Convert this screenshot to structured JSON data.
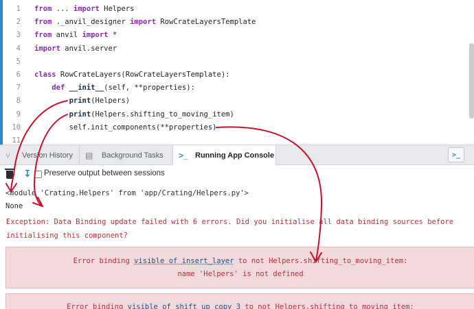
{
  "editor": {
    "lines": [
      {
        "n": "1",
        "parts": [
          [
            "kw",
            "from"
          ],
          [
            "t",
            " ... "
          ],
          [
            "kw",
            "import"
          ],
          [
            "t",
            " Helpers"
          ]
        ]
      },
      {
        "n": "2",
        "parts": [
          [
            "kw",
            "from"
          ],
          [
            "t",
            " ._anvil_designer "
          ],
          [
            "kw",
            "import"
          ],
          [
            "t",
            " RowCrateLayersTemplate"
          ]
        ]
      },
      {
        "n": "3",
        "parts": [
          [
            "kw",
            "from"
          ],
          [
            "t",
            " anvil "
          ],
          [
            "kw",
            "import"
          ],
          [
            "t",
            " *"
          ]
        ]
      },
      {
        "n": "4",
        "parts": [
          [
            "kw",
            "import"
          ],
          [
            "t",
            " anvil.server"
          ]
        ]
      },
      {
        "n": "5",
        "parts": []
      },
      {
        "n": "6",
        "parts": [
          [
            "kw",
            "class"
          ],
          [
            "t",
            " RowCrateLayers(RowCrateLayersTemplate):"
          ]
        ]
      },
      {
        "n": "7",
        "parts": [
          [
            "t",
            "    "
          ],
          [
            "kw",
            "def"
          ],
          [
            "t",
            " "
          ],
          [
            "fn",
            "__init__"
          ],
          [
            "t",
            "(self, **properties):"
          ]
        ]
      },
      {
        "n": "8",
        "parts": [
          [
            "t",
            "        "
          ],
          [
            "fn",
            "print"
          ],
          [
            "t",
            "(Helpers)"
          ]
        ]
      },
      {
        "n": "9",
        "parts": [
          [
            "t",
            "        "
          ],
          [
            "fn",
            "print"
          ],
          [
            "t",
            "(Helpers.shifting_to_moving_item)"
          ]
        ]
      },
      {
        "n": "10",
        "parts": [
          [
            "t",
            "        self.init_components(**properties)"
          ]
        ]
      },
      {
        "n": "11",
        "parts": []
      }
    ]
  },
  "tabs": [
    {
      "label": "Version History",
      "icon": "branch-icon"
    },
    {
      "label": "Background Tasks",
      "icon": "tasks-icon"
    },
    {
      "label": "Running App Console",
      "icon": "console-icon"
    }
  ],
  "toolbar": {
    "preserve_label": "Preserve output between sessions"
  },
  "console": {
    "line1": "<module 'Crating.Helpers' from 'app/Crating/Helpers.py'>",
    "line2": "None",
    "exception_1": "Exception: Data Binding update failed with 6 errors. Did you initialise all data binding sources before",
    "exception_2": "initialising this component?",
    "errors": [
      {
        "prefix": "Error binding ",
        "prop": "visible",
        "of": " of ",
        "component": "insert_layer",
        "to_text": " to not Helpers.shifting_to_moving_item:",
        "message": "name 'Helpers' is not defined"
      },
      {
        "prefix": "Error binding ",
        "prop": "visible",
        "of": " of ",
        "component": "shift_up_copy_3",
        "to_text": " to not Helpers.shifting_to_moving_item:",
        "message": ""
      }
    ]
  },
  "colors": {
    "accent": "#2f86d6",
    "error_text": "#b5323a",
    "error_bg": "#f2d9dc",
    "annotation": "#c8102e"
  }
}
